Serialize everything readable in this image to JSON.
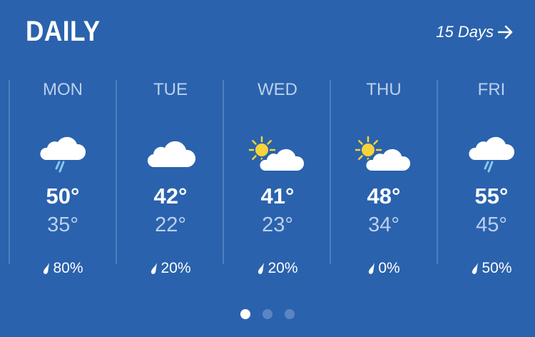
{
  "header": {
    "title": "DAILY",
    "link_label": "15 Days",
    "link_icon": "arrow-right-icon"
  },
  "days": [
    {
      "name": "MON",
      "icon": "rain-cloud-icon",
      "high": "50°",
      "low": "35°",
      "precip": "80%"
    },
    {
      "name": "TUE",
      "icon": "cloud-icon",
      "high": "42°",
      "low": "22°",
      "precip": "20%"
    },
    {
      "name": "WED",
      "icon": "partly-cloudy-icon",
      "high": "41°",
      "low": "23°",
      "precip": "20%"
    },
    {
      "name": "THU",
      "icon": "partly-cloudy-icon",
      "high": "48°",
      "low": "34°",
      "precip": "0%"
    },
    {
      "name": "FRI",
      "icon": "rain-cloud-icon",
      "high": "55°",
      "low": "45°",
      "precip": "50%"
    }
  ],
  "pagination": {
    "pages": 3,
    "active_page": 1
  },
  "colors": {
    "background": "#2a62ad",
    "muted_text": "#bcd0ec",
    "sun": "#f5d33a",
    "rain": "#8fc4ee"
  }
}
